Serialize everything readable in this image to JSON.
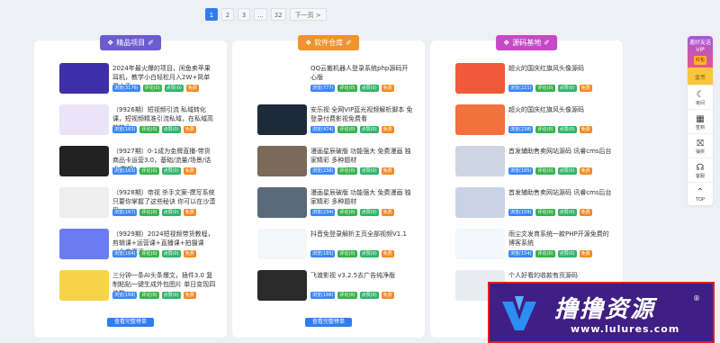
{
  "pagination": {
    "pages": [
      "1",
      "2",
      "3",
      "...",
      "32"
    ],
    "next": "下一页 >",
    "active_index": 0
  },
  "tag_labels": {
    "view": "浏览",
    "comment": "评论",
    "like": "点赞",
    "free": "免费"
  },
  "columns": [
    {
      "title": "精品项目",
      "ribbon_color": "#6d5bd0",
      "more": "查看完整榜单",
      "items": [
        {
          "title": "2024年最火爆的项目，闲鱼卖苹果耳机，教学小白轻松月入2W+简单易上手",
          "views": "3176",
          "comments": "0",
          "likes": "0",
          "thumb": "#3c2fa8"
        },
        {
          "title": "（9926期）短视频引流 私域转化课，短视频精准引流私域，在私域高效转化...",
          "views": "163",
          "comments": "0",
          "likes": "0",
          "thumb": "#e9e4f7"
        },
        {
          "title": "（9927期）0-1成为金牌直播-带货商品卡运营3.0，基础/流量/场景/话术/数据/...",
          "views": "163",
          "comments": "0",
          "likes": "0",
          "thumb": "#222"
        },
        {
          "title": "（9928期）帝视 杀手文案-撰写系统 只要你掌握了这些秘诀 你可以在沙漠里...",
          "views": "167",
          "comments": "0",
          "likes": "0",
          "thumb": "#eeeeee"
        },
        {
          "title": "（9929期）2024短视频带货教程，剪辑课+运营课+直播课+拍摄课（全套原滴...",
          "views": "164",
          "comments": "0",
          "likes": "0",
          "thumb": "#6b7cf0"
        },
        {
          "title": "三分钟一条AI头条爆文，插件3.0 复制粘贴一键生成外包图片 单日变现四位数",
          "views": "168",
          "comments": "0",
          "likes": "0",
          "thumb": "#f7d34a"
        }
      ]
    },
    {
      "title": "软件仓库",
      "ribbon_color": "#f0932b",
      "more": "查看完整榜单",
      "items": [
        {
          "title": "QQ云搬机器人登录系统php源码开心版",
          "views": "777",
          "comments": "0",
          "likes": "0",
          "thumb": "#ffffff"
        },
        {
          "title": "安乐视 全网VIP蓝光视频解析脚本 免登录付费影视免费看",
          "views": "474",
          "comments": "0",
          "likes": "0",
          "thumb": "#1d2a3a"
        },
        {
          "title": "漫画星辰破版 功能强大 免费漫画 独家精彩 多种题材",
          "views": "238",
          "comments": "0",
          "likes": "0",
          "thumb": "#7a6a5a"
        },
        {
          "title": "漫画星辰破版 功能强大 免费漫画 独家精彩 多种题材",
          "views": "234",
          "comments": "0",
          "likes": "0",
          "thumb": "#5a6a7a"
        },
        {
          "title": "抖音免登录解析主页全部视频V1.1",
          "views": "185",
          "comments": "0",
          "likes": "0",
          "thumb": "#f4f6f8"
        },
        {
          "title": "飞渡影视 v3.2.5去广告纯净版",
          "views": "186",
          "comments": "0",
          "likes": "0",
          "thumb": "#2a2a2a"
        }
      ]
    },
    {
      "title": "源码基地",
      "ribbon_color": "#c64ac8",
      "more": "",
      "items": [
        {
          "title": "超火的国庆红旗风头像源码",
          "views": "221",
          "comments": "0",
          "likes": "0",
          "thumb": "#f05a3a"
        },
        {
          "title": "超火的国庆红旗风头像源码",
          "views": "238",
          "comments": "0",
          "likes": "0",
          "thumb": "#f2713d"
        },
        {
          "title": "首发辅助售卖网站源码 讯睿cms后台",
          "views": "165",
          "comments": "0",
          "likes": "0",
          "thumb": "#cdd5e2"
        },
        {
          "title": "首发辅助售卖网站源码 讯睿cms后台",
          "views": "159",
          "comments": "0",
          "likes": "0",
          "thumb": "#c9d3e6"
        },
        {
          "title": "雨尘文发育系统一款PHP开源免费的博客系统",
          "views": "154",
          "comments": "0",
          "likes": "0",
          "thumb": "#f3f6fa"
        },
        {
          "title": "个人好看的收款有页源码",
          "views": "",
          "comments": "",
          "likes": "",
          "thumb": "#e8ecf2"
        }
      ]
    }
  ],
  "sidebar": {
    "vip": "邀好友送VIP",
    "gift": "红包",
    "coin": "金币",
    "buttons": [
      {
        "label": "夜间",
        "icon": "☾",
        "icon_name": "moon-icon"
      },
      {
        "label": "签到",
        "icon": "▦",
        "icon_name": "calendar-icon"
      },
      {
        "label": "抽奖",
        "icon": "⛝",
        "icon_name": "gift-icon"
      },
      {
        "label": "客服",
        "icon": "☊",
        "icon_name": "headset-icon"
      },
      {
        "label": "TOP",
        "icon": "⌃",
        "icon_name": "arrow-up-icon"
      }
    ]
  },
  "brand": {
    "name": "撸撸资源",
    "url": "www.lulures.com",
    "reg": "®"
  }
}
